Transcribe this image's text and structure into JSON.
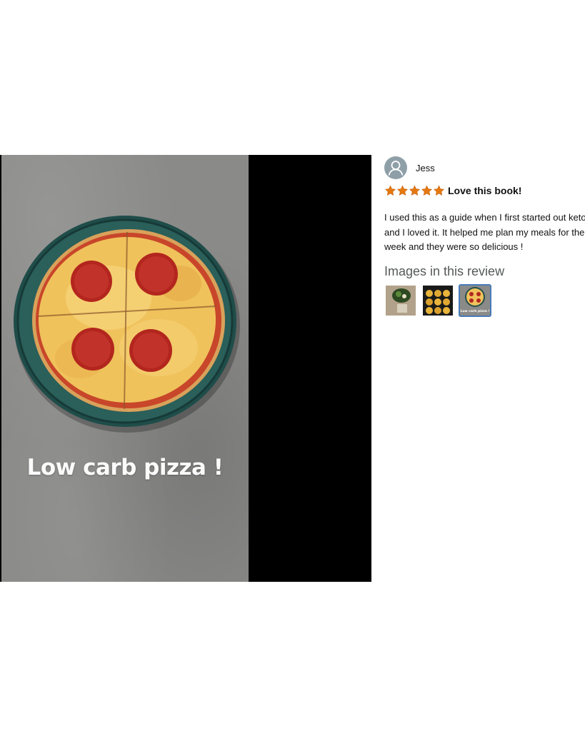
{
  "viewer": {
    "photo_caption": "Low carb pizza !",
    "photo_alt": "pizza"
  },
  "review": {
    "reviewer_name": "Jess",
    "avatar_icon": "person-icon",
    "rating": 5,
    "rating_max": 5,
    "star_color": "#e47911",
    "title": "Love this book!",
    "body": "I used this as a guide when I first started out keto and I loved it. It helped me plan my meals for the week and they were so delicious !",
    "images_heading": "Images in this review",
    "thumbnails": [
      {
        "name": "thumbnail-salad",
        "selected": false,
        "caption": ""
      },
      {
        "name": "thumbnail-egg-cups",
        "selected": false,
        "caption": ""
      },
      {
        "name": "thumbnail-pizza",
        "selected": true,
        "caption": "Low carb pizza !"
      }
    ],
    "selection_color": "#4a7ab8"
  }
}
